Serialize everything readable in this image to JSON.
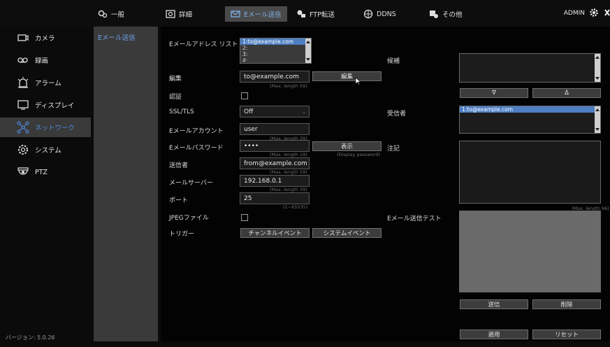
{
  "topbar": {
    "tabs": [
      {
        "label": "一般"
      },
      {
        "label": "詳細"
      },
      {
        "label": "Eメール送信"
      },
      {
        "label": "FTP転送"
      },
      {
        "label": "DDNS"
      },
      {
        "label": "その他"
      }
    ],
    "user": "ADMIN"
  },
  "sidebar": {
    "items": [
      {
        "label": "カメラ"
      },
      {
        "label": "録画"
      },
      {
        "label": "アラーム"
      },
      {
        "label": "ディスプレイ"
      },
      {
        "label": "ネットワーク"
      },
      {
        "label": "システム"
      },
      {
        "label": "PTZ"
      }
    ],
    "version": "バージョン: 5.0.26"
  },
  "subnav": {
    "item": "Eメール送信"
  },
  "form": {
    "list_label": "Eメールアドレス リスト",
    "list_items": [
      "1:to@example.com",
      "2:",
      "3:",
      "4:"
    ],
    "edit_label": "編集",
    "edit_value": "to@example.com",
    "edit_hint": "(Max. length 59)",
    "edit_button": "編集",
    "auth_label": "認証",
    "ssl_label": "SSL/TLS",
    "ssl_value": "Off",
    "account_label": "Eメールアカウント",
    "account_value": "user",
    "account_hint": "(Max. length 39)",
    "password_label": "Eメールパスワード",
    "password_value": "••••",
    "password_hint": "(Max. length 19)",
    "show_button": "表示",
    "show_hint": "(Display password)",
    "sender_label": "送信者",
    "sender_value": "from@example.com",
    "sender_hint": "(Max. length 59)",
    "server_label": "メールサーバー",
    "server_value": "192.168.0.1",
    "server_hint": "(Max. length 39)",
    "port_label": "ポート",
    "port_value": "25",
    "port_hint": "(1~65535)",
    "jpeg_label": "JPEGファイル",
    "trigger_label": "トリガー",
    "channel_event_button": "チャンネルイベント",
    "system_event_button": "システムイベント"
  },
  "right": {
    "candidate_label": "候補",
    "down_button": "∇",
    "up_button": "Δ",
    "recipient_label": "受信者",
    "recipient_items": [
      "1:to@example.com"
    ],
    "note_label": "注記",
    "note_hint": "(Max. length 96)",
    "test_label": "Eメール送信テスト",
    "send_button": "送信",
    "delete_button": "削除",
    "apply_button": "適用",
    "reset_button": "リセット"
  }
}
